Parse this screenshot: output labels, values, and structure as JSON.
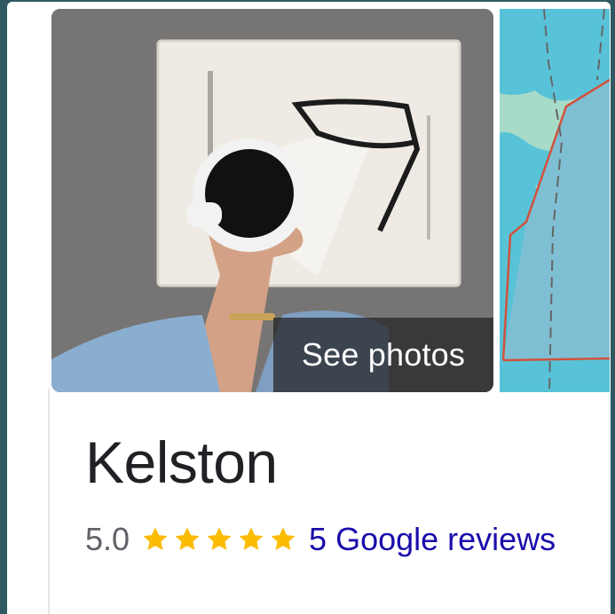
{
  "photo": {
    "see_photos_label": "See photos"
  },
  "place": {
    "title": "Kelston",
    "rating": "5.0",
    "rating_stars": 5,
    "reviews_label": "5 Google reviews"
  },
  "colors": {
    "star": "#fbbc04",
    "link": "#1a0dab",
    "title": "#202124",
    "rating_text": "#5f6368",
    "map_water": "#58c3d8",
    "map_boundary": "#d2513b"
  },
  "icons": {
    "star": "star-icon"
  }
}
